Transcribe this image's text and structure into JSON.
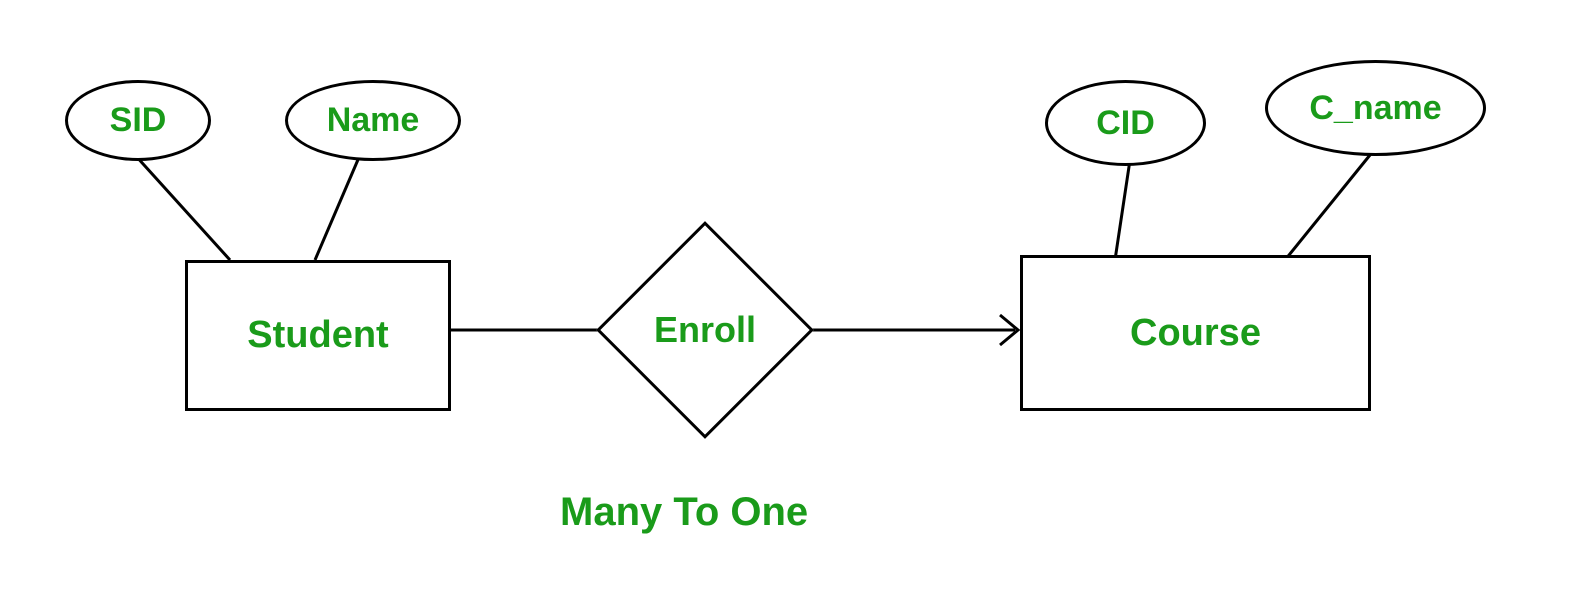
{
  "diagram": {
    "type": "er-diagram",
    "caption": "Many To One",
    "entities": {
      "student": {
        "label": "Student",
        "attributes": {
          "sid": "SID",
          "name": "Name"
        }
      },
      "course": {
        "label": "Course",
        "attributes": {
          "cid": "CID",
          "cname": "C_name"
        }
      }
    },
    "relationship": {
      "label": "Enroll",
      "from": "student",
      "to": "course",
      "cardinality": "many-to-one"
    }
  }
}
